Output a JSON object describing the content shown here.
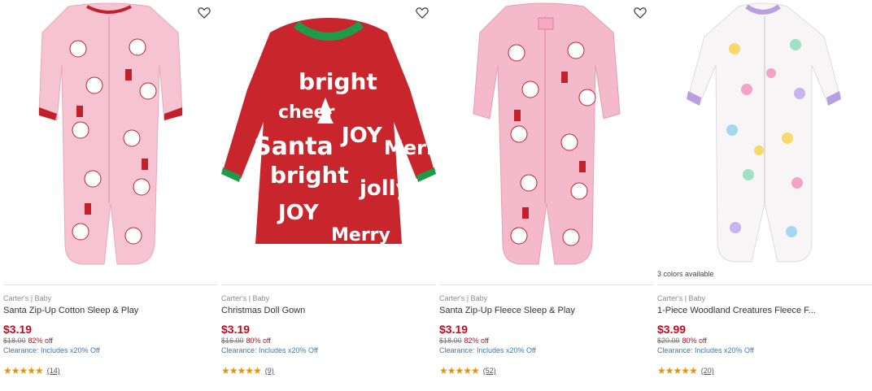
{
  "products": [
    {
      "colors_note": "",
      "brand": "Carter's | Baby",
      "title": "Santa Zip-Up Cotton Sleep & Play",
      "price": "$3.19",
      "was_price": "$18.00",
      "percent_off": "82% off",
      "clearance": "Clearance: Includes x20% Off",
      "stars": "★★★★★",
      "reviews": "(14)",
      "rating": 5
    },
    {
      "colors_note": "",
      "brand": "Carter's | Baby",
      "title": "Christmas Doll Gown",
      "price": "$3.19",
      "was_price": "$16.00",
      "percent_off": "80% off",
      "clearance": "Clearance: Includes x20% Off",
      "stars": "★★★★★",
      "reviews": "(9)",
      "rating": 5
    },
    {
      "colors_note": "",
      "brand": "Carter's | Baby",
      "title": "Santa Zip-Up Fleece Sleep & Play",
      "price": "$3.19",
      "was_price": "$18.00",
      "percent_off": "82% off",
      "clearance": "Clearance: Includes x20% Off",
      "stars": "★★★★★",
      "reviews": "(52)",
      "rating": 5
    },
    {
      "colors_note": "3 colors available",
      "brand": "Carter's | Baby",
      "title": "1-Piece Woodland Creatures Fleece F...",
      "price": "$3.99",
      "was_price": "$20.00",
      "percent_off": "80% off",
      "clearance": "Clearance: Includes x20% Off",
      "stars": "★★★★★",
      "reviews": "(20)",
      "rating": 5
    }
  ],
  "gown_print_words": [
    "bright",
    "cheer",
    "Santa",
    "JOY",
    "Merry",
    "bright",
    "jolly",
    "JOY",
    "Merry"
  ],
  "colors": {
    "price_red": "#d0021b",
    "clearance_blue": "#2a7ec9",
    "star_orange": "#e8930c",
    "pajama_pink": "#f6c3d2",
    "gown_red": "#c9252c",
    "gown_trim_green": "#1f9a4a",
    "woodland_lilac": "#b79fe0"
  }
}
